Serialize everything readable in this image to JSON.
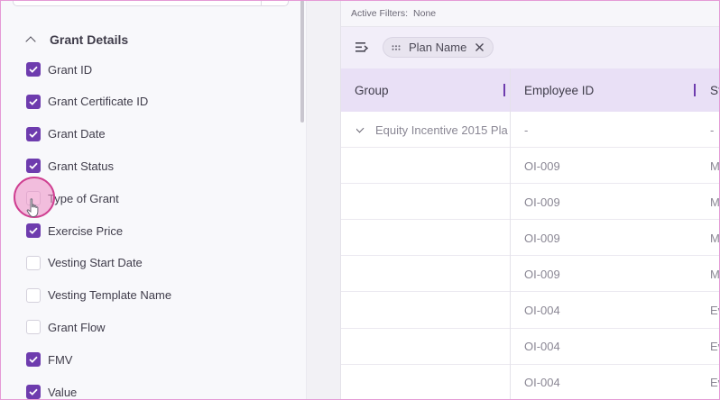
{
  "column_panel": {
    "section_title": "Grant Details",
    "items": [
      {
        "label": "Grant ID",
        "checked": true
      },
      {
        "label": "Grant Certificate ID",
        "checked": true
      },
      {
        "label": "Grant Date",
        "checked": true
      },
      {
        "label": "Grant Status",
        "checked": true
      },
      {
        "label": "Type of Grant",
        "checked": false
      },
      {
        "label": "Exercise Price",
        "checked": true
      },
      {
        "label": "Vesting Start Date",
        "checked": false
      },
      {
        "label": "Vesting Template Name",
        "checked": false
      },
      {
        "label": "Grant Flow",
        "checked": false
      },
      {
        "label": "FMV",
        "checked": true
      },
      {
        "label": "Value",
        "checked": true
      }
    ]
  },
  "grid": {
    "filters_label": "Active Filters:",
    "filters_value": "None",
    "group_chip": "Plan Name",
    "headers": [
      "Group",
      "Employee ID",
      "St"
    ],
    "rows": [
      {
        "group": "Equity Incentive 2015 Pla",
        "employee_id": "-",
        "status": "-",
        "expandable": true
      },
      {
        "group": "",
        "employee_id": "OI-009",
        "status": "M",
        "expandable": false
      },
      {
        "group": "",
        "employee_id": "OI-009",
        "status": "M",
        "expandable": false
      },
      {
        "group": "",
        "employee_id": "OI-009",
        "status": "M",
        "expandable": false
      },
      {
        "group": "",
        "employee_id": "OI-009",
        "status": "M",
        "expandable": false
      },
      {
        "group": "",
        "employee_id": "OI-004",
        "status": "Ev",
        "expandable": false
      },
      {
        "group": "",
        "employee_id": "OI-004",
        "status": "Ev",
        "expandable": false
      },
      {
        "group": "",
        "employee_id": "OI-004",
        "status": "Ev",
        "expandable": false
      }
    ]
  },
  "colors": {
    "accent": "#6e3cae",
    "header_bg": "#e9e0f6",
    "click_highlight": "#cf3f91"
  },
  "icons": [
    "chevron-up-icon",
    "checkbox-icon",
    "hand-pointer-icon",
    "group-rows-icon",
    "drag-handle-icon",
    "close-icon",
    "chevron-down-icon"
  ]
}
